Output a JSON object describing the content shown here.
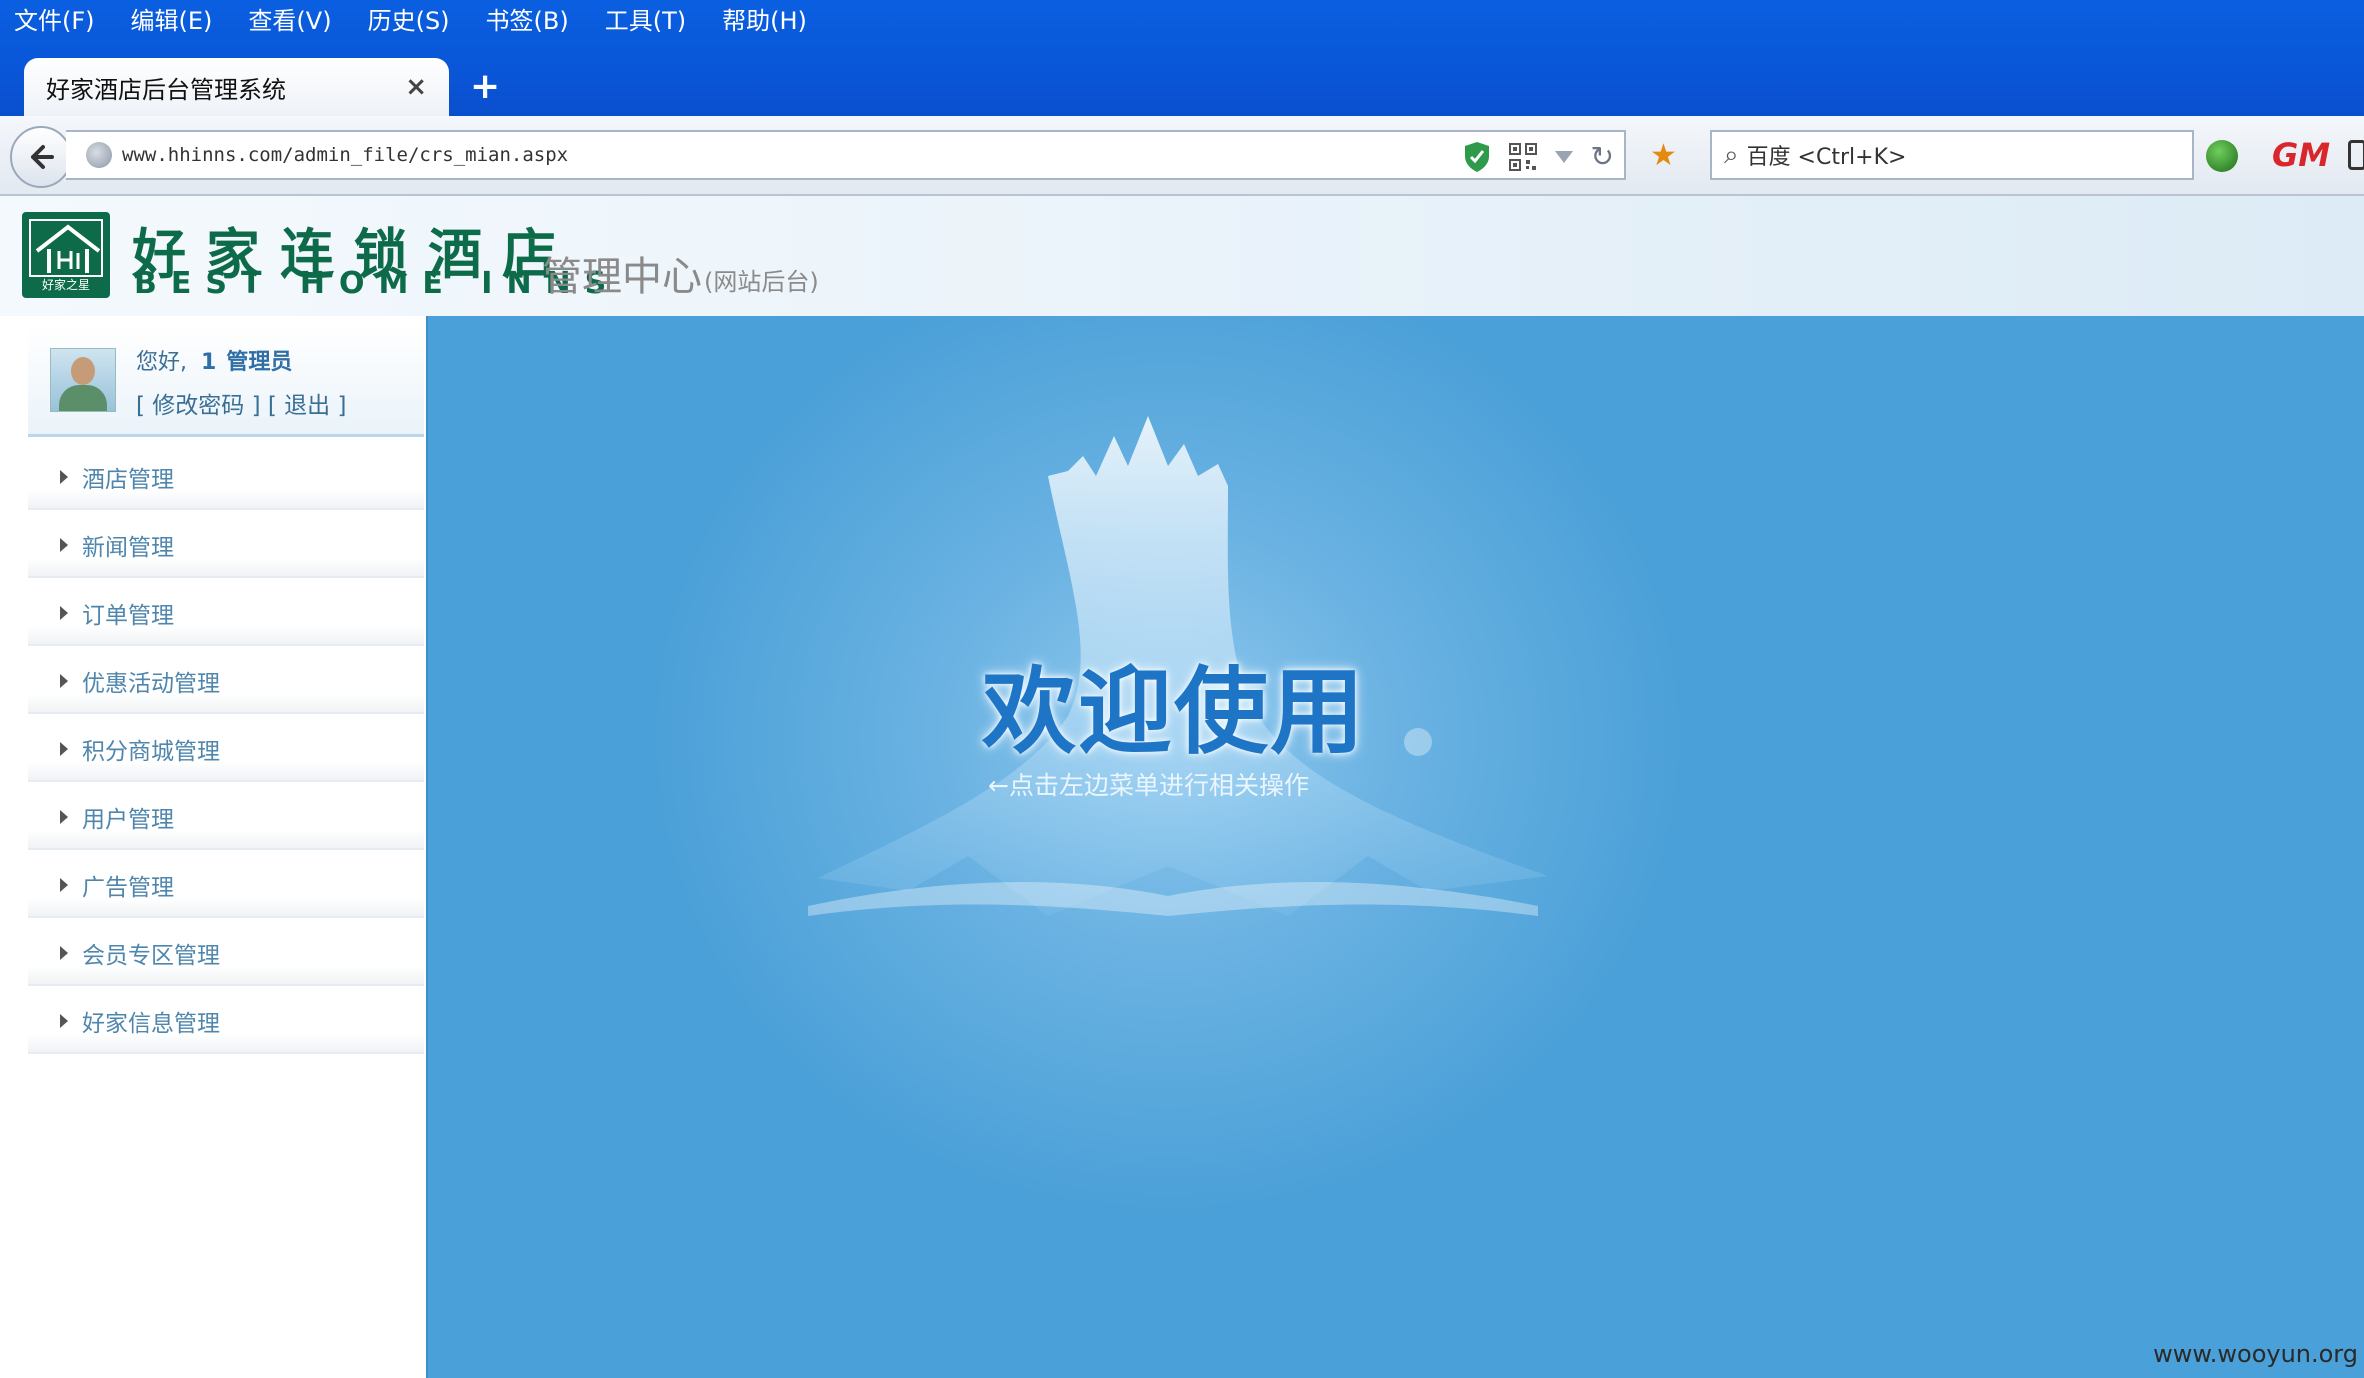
{
  "browser": {
    "menu": [
      "文件(F)",
      "编辑(E)",
      "查看(V)",
      "历史(S)",
      "书签(B)",
      "工具(T)",
      "帮助(H)"
    ],
    "tab_title": "好家酒店后台管理系统",
    "tab_close": "×",
    "new_tab": "+",
    "url": "www.hhinns.com/admin_file/crs_mian.aspx",
    "search_placeholder": "百度 <Ctrl+K>",
    "ext_gm": "GM"
  },
  "header": {
    "brand_cn": "好家连锁酒店",
    "brand_en": "BEST HOME INNS",
    "logo_text": "好家之星",
    "admin_title": "管理中心",
    "admin_subtitle": "(网站后台)"
  },
  "user": {
    "greeting": "您好,",
    "name": "1",
    "role": "管理员",
    "change_password": "[ 修改密码 ]",
    "logout": "[ 退出 ]"
  },
  "sidebar": {
    "items": [
      "酒店管理",
      "新闻管理",
      "订单管理",
      "优惠活动管理",
      "积分商城管理",
      "用户管理",
      "广告管理",
      "会员专区管理",
      "好家信息管理"
    ]
  },
  "main": {
    "welcome_title": "欢迎使用",
    "welcome_subtitle": "←点击左边菜单进行相关操作"
  },
  "watermark": "www.wooyun.org"
}
